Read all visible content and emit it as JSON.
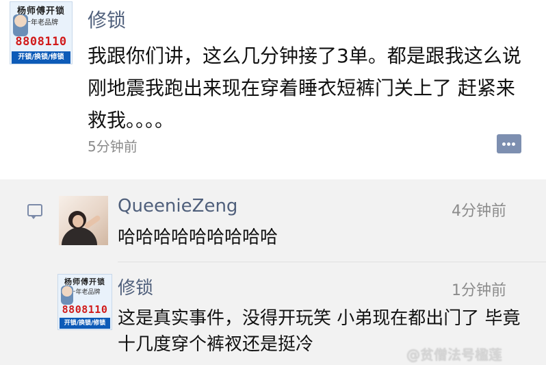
{
  "post": {
    "avatar": {
      "brand": "杨师傅开锁",
      "slogan": "十年老品牌",
      "phone": "8808110",
      "services": "开锁/换锁/修锁"
    },
    "author": "修锁",
    "text": "我跟你们讲，这么几分钟接了3单。都是跟我这么说 刚地震我跑出来现在穿着睡衣短裤门关上了 赶紧来救我。。。。",
    "time": "5分钟前"
  },
  "comments": [
    {
      "author": "QueenieZeng",
      "time": "4分钟前",
      "text": "哈哈哈哈哈哈哈哈哈"
    },
    {
      "author": "修锁",
      "time": "1分钟前",
      "text": "这是真实事件，没得开玩笑 小弟现在都出门了 毕竟十几度穿个裤衩还是挺冷",
      "avatar": {
        "brand": "杨师傅开锁",
        "slogan": "十年老品牌",
        "phone": "8808110",
        "services": "开锁/换锁/修锁"
      }
    }
  ],
  "watermark": "@贫僧法号楹莲",
  "icons": {
    "comment_button": "comment-bubble-icon",
    "panel": "comment-icon"
  }
}
